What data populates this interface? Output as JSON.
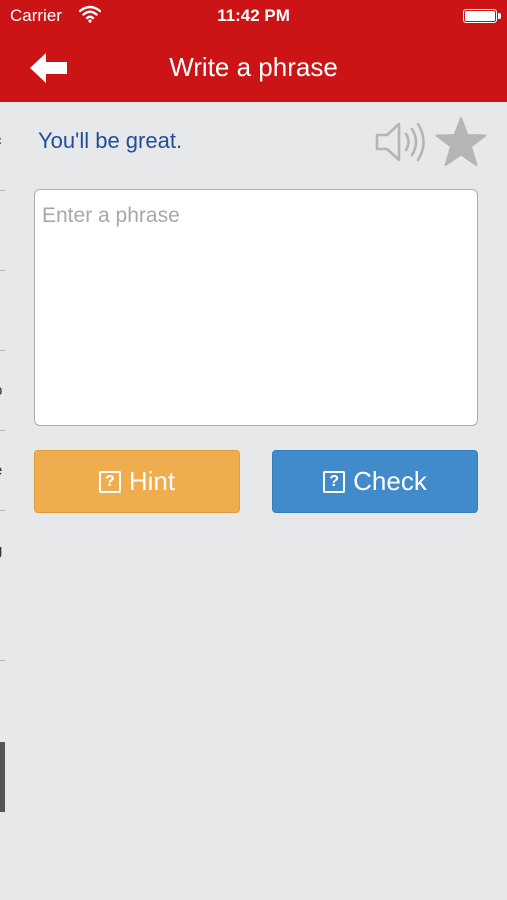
{
  "status_bar": {
    "carrier": "Carrier",
    "time": "11:42 PM"
  },
  "nav": {
    "title": "Write a phrase"
  },
  "prompt": {
    "text": "You'll be great."
  },
  "input": {
    "placeholder": "Enter a phrase",
    "value": ""
  },
  "buttons": {
    "hint_label": "Hint",
    "check_label": "Check",
    "hint_icon": "?",
    "check_icon": "?"
  },
  "colors": {
    "header": "#cc1417",
    "background": "#e6e8ea",
    "prompt_text": "#1f4f99",
    "hint_button": "#f0ad4e",
    "check_button": "#428bca",
    "icon_gray": "#b5b5b5"
  }
}
